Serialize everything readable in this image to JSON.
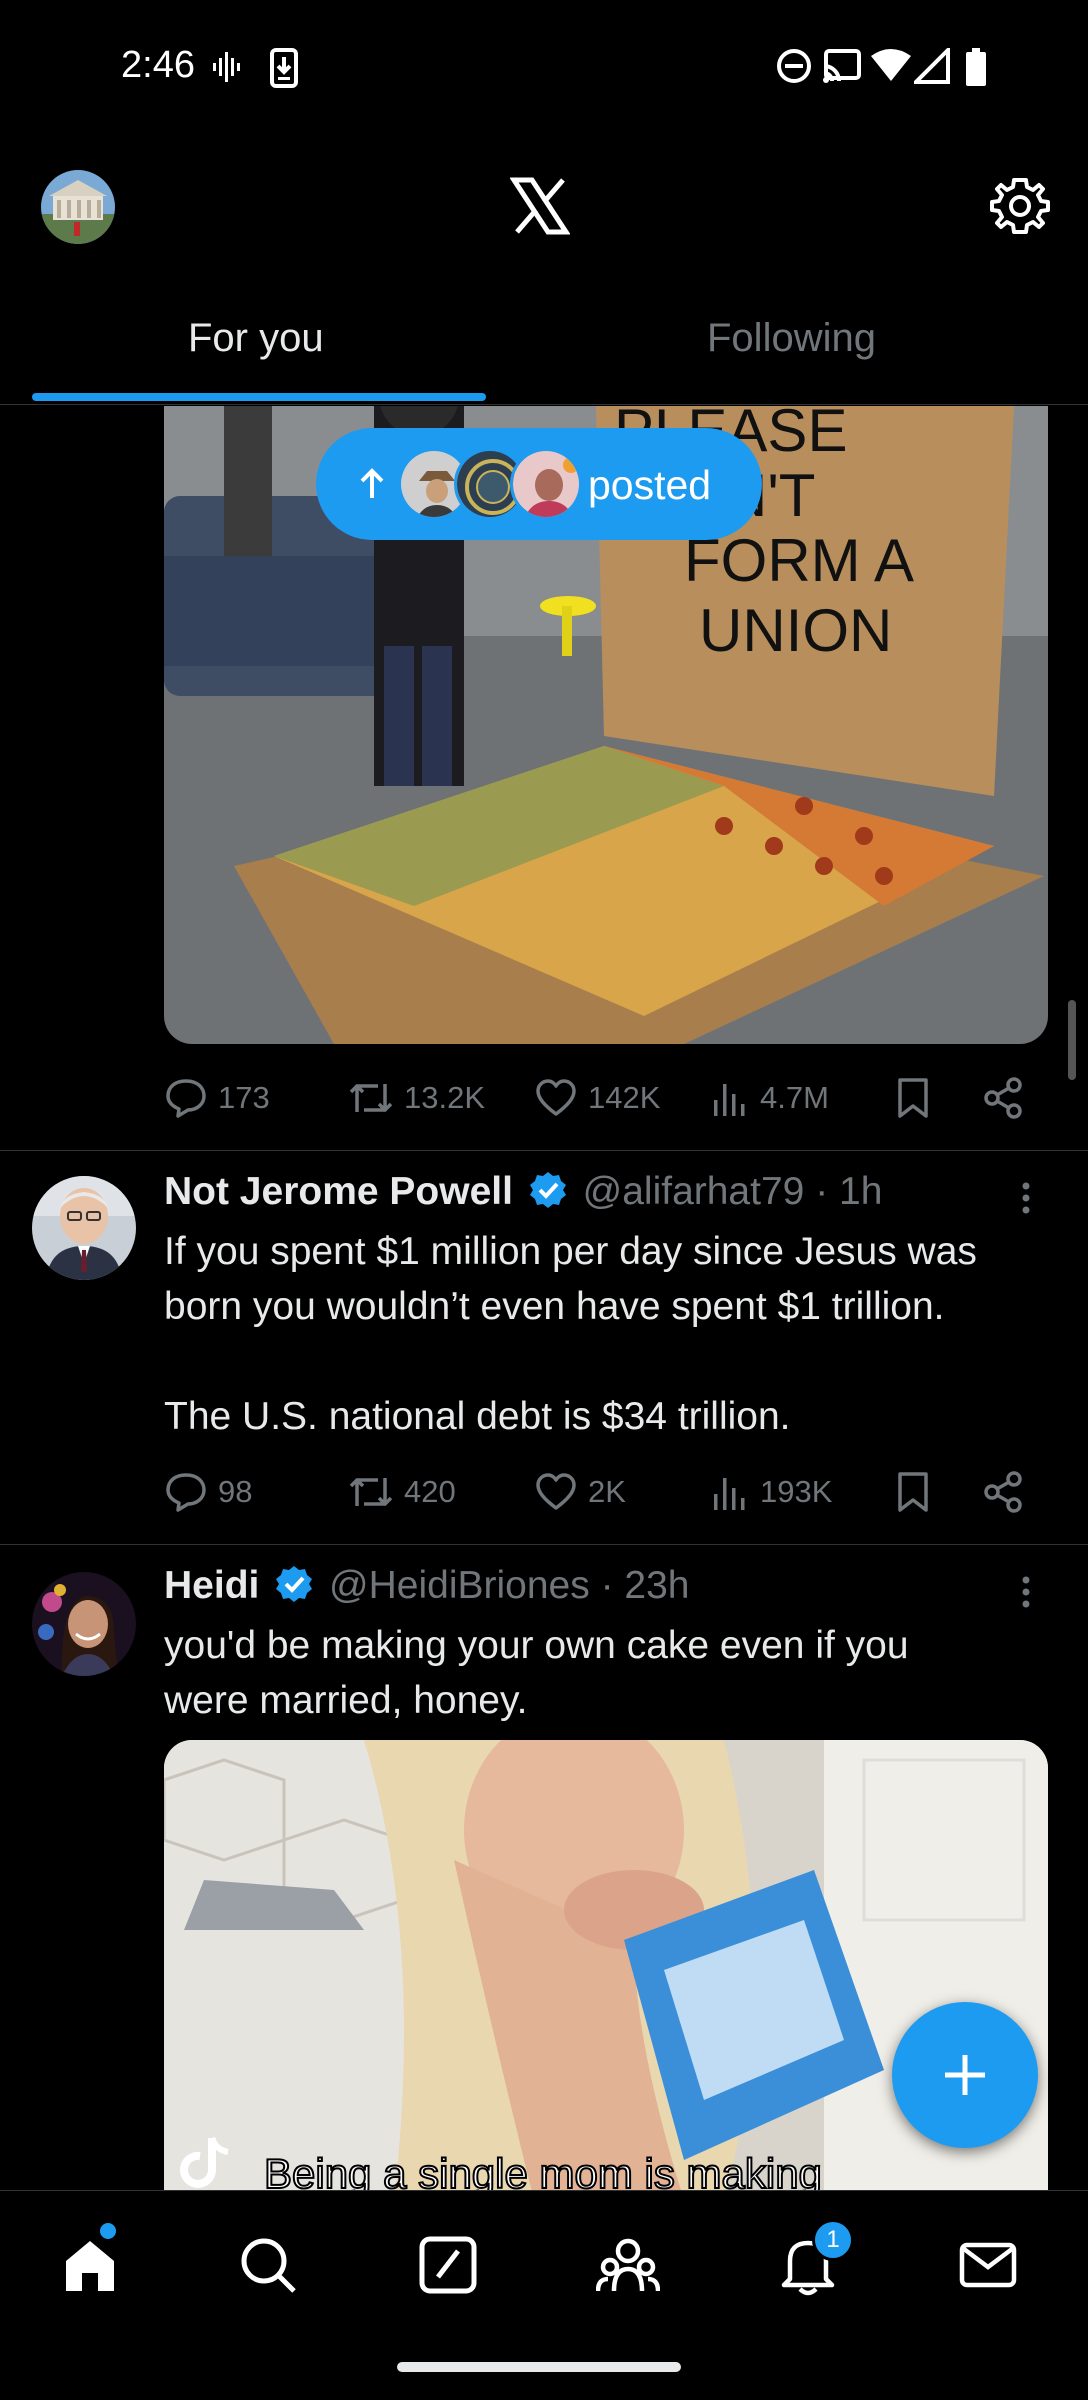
{
  "status_bar": {
    "time": "2:46"
  },
  "tabs": [
    {
      "label": "For you",
      "selected": true
    },
    {
      "label": "Following",
      "selected": false
    }
  ],
  "posted_pill": {
    "label": "posted"
  },
  "tweets": [
    {
      "media_text": [
        "PLEASE",
        "DON'T",
        "FORM A",
        "UNION"
      ],
      "stats": {
        "replies": "173",
        "reposts": "13.2K",
        "likes": "142K",
        "views": "4.7M"
      }
    },
    {
      "name": "Not Jerome Powell",
      "verified": true,
      "handle": "@alifarhat79",
      "time": "· 1h",
      "text_lines": [
        "If you spent $1 million per day since Jesus was",
        "born you wouldn’t even have spent $1 trillion.",
        "",
        "The U.S. national debt is $34 trillion."
      ],
      "stats": {
        "replies": "98",
        "reposts": "420",
        "likes": "2K",
        "views": "193K"
      }
    },
    {
      "name": "Heidi",
      "verified": true,
      "handle": "@HeidiBriones",
      "time": "· 23h",
      "text_lines": [
        "you'd be making your own cake even if you",
        "were married, honey."
      ],
      "media_caption": "Being a single mom is making"
    }
  ],
  "bottom_nav": {
    "items": [
      "home",
      "search",
      "grok",
      "communities",
      "notifications",
      "messages"
    ],
    "notification_count": "1"
  },
  "colors": {
    "accent": "#1d9bf0",
    "background": "#000000",
    "muted": "#71767b"
  }
}
